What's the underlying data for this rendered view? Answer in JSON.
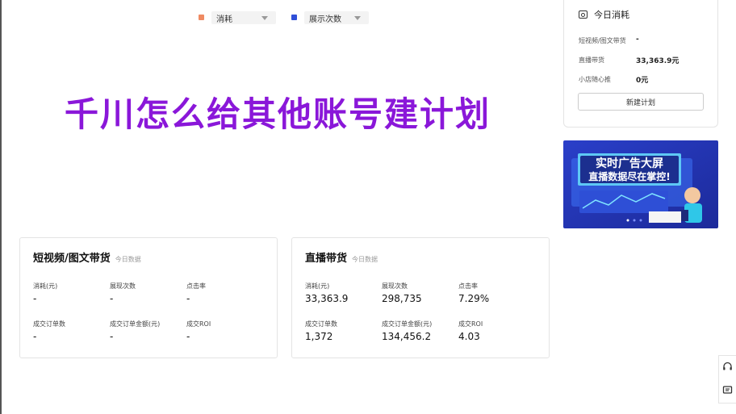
{
  "legend": [
    {
      "label": "消耗",
      "color": "#ef8a62"
    },
    {
      "label": "展示次数",
      "color": "#2f4fd8"
    }
  ],
  "headline": "千川怎么给其他账号建计划",
  "today_panel": {
    "title": "今日消耗",
    "rows": [
      {
        "label": "短视频/图文带货",
        "value": "-"
      },
      {
        "label": "直播带货",
        "value": "33,363.9元"
      },
      {
        "label": "小店随心推",
        "value": "0元"
      }
    ],
    "button": "新建计划"
  },
  "banner": {
    "line1": "实时广告大屏",
    "line2": "直播数据尽在掌控!"
  },
  "cards": [
    {
      "title": "短视频/图文带货",
      "subtitle": "今日数据",
      "metrics": [
        {
          "label": "消耗(元)",
          "value": "-"
        },
        {
          "label": "展现次数",
          "value": "-"
        },
        {
          "label": "点击率",
          "value": "-"
        },
        {
          "label": "成交订单数",
          "value": "-"
        },
        {
          "label": "成交订单金额(元)",
          "value": "-"
        },
        {
          "label": "成交ROI",
          "value": "-"
        }
      ]
    },
    {
      "title": "直播带货",
      "subtitle": "今日数据",
      "metrics": [
        {
          "label": "消耗(元)",
          "value": "33,363.9"
        },
        {
          "label": "展现次数",
          "value": "298,735"
        },
        {
          "label": "点击率",
          "value": "7.29%"
        },
        {
          "label": "成交订单数",
          "value": "1,372"
        },
        {
          "label": "成交订单金额(元)",
          "value": "134,456.2"
        },
        {
          "label": "成交ROI",
          "value": "4.03"
        }
      ]
    }
  ],
  "side_tools": [
    "headset-icon",
    "message-icon"
  ]
}
